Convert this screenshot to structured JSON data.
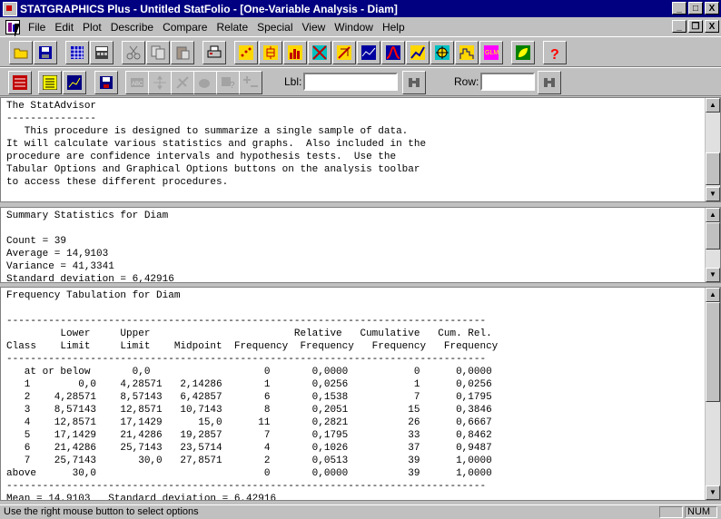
{
  "window": {
    "title": "STATGRAPHICS Plus - Untitled StatFolio - [One-Variable Analysis - Diam]",
    "minimize": "_",
    "maximize": "□",
    "close": "X",
    "restore": "ð",
    "mdi_close": "X"
  },
  "menu": [
    {
      "label": "File"
    },
    {
      "label": "Edit"
    },
    {
      "label": "Plot"
    },
    {
      "label": "Describe"
    },
    {
      "label": "Compare"
    },
    {
      "label": "Relate"
    },
    {
      "label": "Special"
    },
    {
      "label": "View"
    },
    {
      "label": "Window"
    },
    {
      "label": "Help"
    }
  ],
  "toolbar2": {
    "lbl_label": "Lbl:",
    "lbl_value": "",
    "row_label": "Row:",
    "row_value": ""
  },
  "colors": {
    "titlebar": "#000080",
    "pane_bg": "#ffffff",
    "chrome": "#c0c0c0"
  },
  "panes": {
    "statadvisor": "The StatAdvisor\n---------------\n   This procedure is designed to summarize a single sample of data.\nIt will calculate various statistics and graphs.  Also included in the\nprocedure are confidence intervals and hypothesis tests.  Use the\nTabular Options and Graphical Options buttons on the analysis toolbar\nto access these different procedures.",
    "summary": "Summary Statistics for Diam\n\nCount = 39\nAverage = 14,9103\nVariance = 41,3341\nStandard deviation = 6,42916",
    "frequency": "Frequency Tabulation for Diam\n\n--------------------------------------------------------------------------------\n         Lower     Upper                        Relative   Cumulative   Cum. Rel.\nClass    Limit     Limit    Midpoint  Frequency  Frequency   Frequency   Frequency\n--------------------------------------------------------------------------------\n   at or below       0,0                   0       0,0000           0      0,0000\n   1        0,0    4,28571   2,14286       1       0,0256           1      0,0256\n   2    4,28571    8,57143   6,42857       6       0,1538           7      0,1795\n   3    8,57143    12,8571   10,7143       8       0,2051          15      0,3846\n   4    12,8571    17,1429      15,0      11       0,2821          26      0,6667\n   5    17,1429    21,4286   19,2857       7       0,1795          33      0,8462\n   6    21,4286    25,7143   23,5714       4       0,1026          37      0,9487\n   7    25,7143       30,0   27,8571       2       0,0513          39      1,0000\nabove      30,0                            0       0,0000          39      1,0000\n--------------------------------------------------------------------------------\nMean = 14,9103   Standard deviation = 6,42916"
  },
  "statusbar": {
    "message": "Use the right mouse button to select options",
    "num": "NUM"
  }
}
